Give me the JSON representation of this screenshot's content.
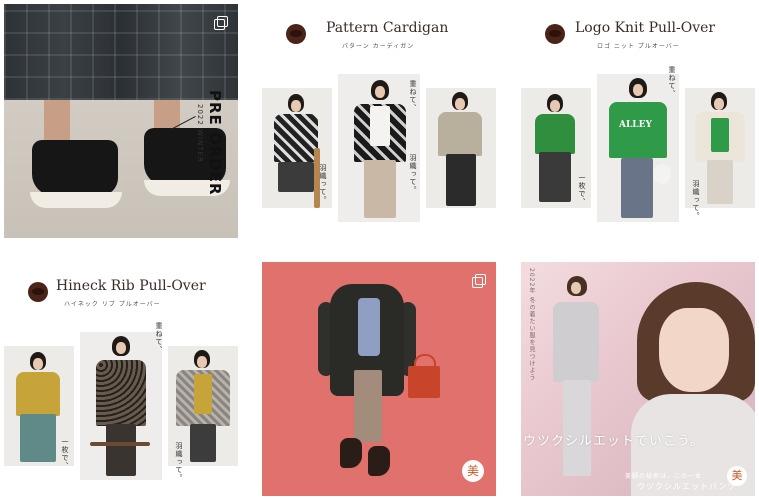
{
  "grid": {
    "tile1": {
      "label": "PRE ORDER",
      "season": "2022 WINTER"
    },
    "tile2": {
      "title": "Pattern Cardigan",
      "subtitle": "パターン カーディガン",
      "caption1": "重ねて、",
      "caption2": "羽織って。"
    },
    "tile3": {
      "title": "Logo Knit Pull-Over",
      "subtitle": "ロゴ ニット プルオーバー",
      "caption1": "重ねて、",
      "caption2": "一枚で、",
      "caption3": "羽織って。",
      "sweater_text": "ALLEY"
    },
    "tile4": {
      "title": "Hineck Rib Pull-Over",
      "subtitle": "ハイネック リブ プルオーバー",
      "caption1": "重ねて、",
      "caption2": "一枚で、",
      "caption3": "羽織って。"
    },
    "tile5": {
      "stamp": "美"
    },
    "tile6": {
      "copy": "ウツクシルエットでいこう。",
      "vertical": "2022年 冬の着たい服を見つけよう",
      "sub": "美脚の秘密は、この一本",
      "brand": "ウツクシルエットパンツ",
      "stamp": "美"
    }
  },
  "icons": [
    "multi-image-icon",
    "brand-logo-icon"
  ],
  "colors": {
    "tile5_bg": "#e1716c",
    "tile6_bg": "#efd2d7",
    "title_text": "#3a2c25"
  }
}
